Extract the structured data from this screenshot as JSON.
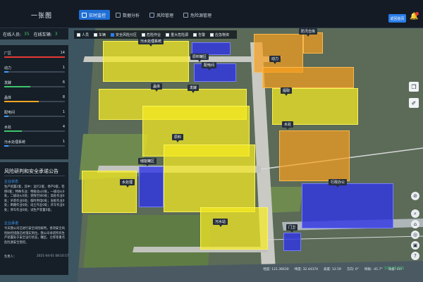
{
  "header": {
    "logo": "一张图",
    "nav": [
      {
        "label": "实时监控",
        "active": true
      },
      {
        "label": "数据分析",
        "active": false
      },
      {
        "label": "风险管理",
        "active": false
      },
      {
        "label": "危险源管理",
        "active": false
      }
    ],
    "back_label": "返回首页"
  },
  "status": {
    "online_label": "在线人员:",
    "online_count": "35",
    "vehicle_label": "在线车辆:",
    "vehicle_count": "3"
  },
  "filters": [
    {
      "label": "人员",
      "checked": false
    },
    {
      "label": "车辆",
      "checked": false
    },
    {
      "label": "安全风险分区",
      "checked": true
    },
    {
      "label": "危险作业",
      "checked": false
    },
    {
      "label": "重大危险源",
      "checked": false
    },
    {
      "label": "告警",
      "checked": false
    },
    {
      "label": "应急物资",
      "checked": false
    }
  ],
  "categories": {
    "max": 14,
    "items": [
      {
        "name": "厂区",
        "count": 14,
        "color": "#e53935"
      },
      {
        "name": "动力",
        "count": 1,
        "color": "#3f9bff"
      },
      {
        "name": "发酵",
        "count": 6,
        "color": "#3ec46d"
      },
      {
        "name": "晶体",
        "count": 8,
        "color": "#f5a623"
      },
      {
        "name": "配电间",
        "count": 1,
        "color": "#3f9bff"
      },
      {
        "name": "水处",
        "count": 4,
        "color": "#3ec46d"
      },
      {
        "name": "污水处理系统",
        "count": 1,
        "color": "#3f9bff"
      }
    ]
  },
  "notice": {
    "title": "风险研判和安全承诺公告",
    "status_heading": "企业状态",
    "status_text": "生产装置2套，其中：运行2套，停产0套，检修0套；特殊作业：特级动火0处，一级动火0处，二级动火0处；受限空间0处；高处作业0处；吊装作业0处；临时用电0处；盲板作业0处；断路作业0处；动土作业0处；开车作业0处；停车作业0处；试生产装置0套。",
    "promise_heading": "企业承诺",
    "promise_text": "今天我公司已进行安全风险研判，各项安全风险防控措施已经落实到位，我公司承诺所有生产装置处于安全运行状态，罐区、仓库等重点危险源安全受控。",
    "author": "负责人：",
    "time": "2021-04-01 08:10:17"
  },
  "map_labels": [
    "污水处理系统",
    "原料罐区",
    "防汛仓库",
    "动力",
    "配电间",
    "晶体",
    "发酵",
    "原料",
    "提取",
    "水处",
    "储能罐区",
    "水处理",
    "行政办公",
    "污水站",
    "门卫"
  ],
  "footer": {
    "coords": [
      "经度: 121.36630",
      "纬度: 32.44374",
      "高度: 12.59",
      "方向: 0°",
      "倾角: -41.7°",
      "海拔: 0m"
    ],
    "fps": "106.35 FPS"
  }
}
